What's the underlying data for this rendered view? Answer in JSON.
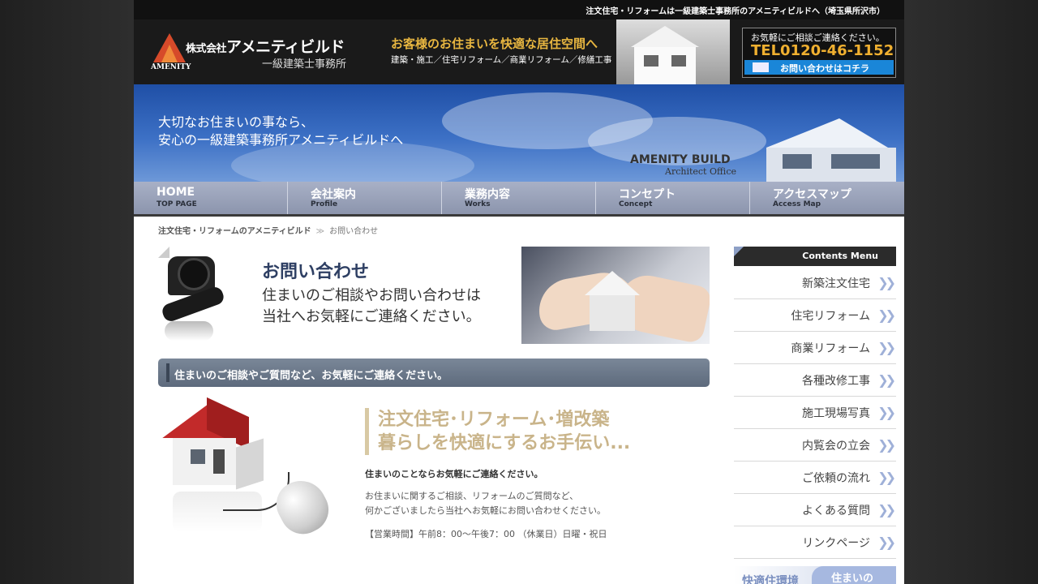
{
  "top_strip": {
    "text": "注文住宅・リフォームは一級建築士事務所のアメニティビルドへ（埼玉県所沢市）"
  },
  "header": {
    "logo_en": "AMENITY",
    "logo_jp_small": "株式会社",
    "logo_jp": "アメニティビルド",
    "logo_sub": "一級建築士事務所",
    "catch": "お客様のお住まいを快適な居住空間へ",
    "catch_sub": "建築・施工／住宅リフォーム／商業リフォーム／修繕工事",
    "contact_text": "お気軽にご相談ご連絡ください。",
    "contact_tel": "TEL0120-46-1152",
    "contact_button": "お問い合わせはコチラ"
  },
  "hero": {
    "line1": "大切なお住まいの事なら、",
    "line2": "安心の一級建築事務所アメニティビルドへ",
    "brand": "AMENITY BUILD",
    "brand_sub": "Architect Office"
  },
  "nav": [
    {
      "jp": "HOME",
      "en": "TOP PAGE"
    },
    {
      "jp": "会社案内",
      "en": "Profile"
    },
    {
      "jp": "業務内容",
      "en": "Works"
    },
    {
      "jp": "コンセプト",
      "en": "Concept"
    },
    {
      "jp": "アクセスマップ",
      "en": "Access Map"
    }
  ],
  "breadcrumb": {
    "home": "注文住宅・リフォームのアメニティビルド",
    "sep": "≫",
    "current": "お問い合わせ"
  },
  "banner": {
    "title": "お問い合わせ",
    "sub1": "住まいのご相談やお問い合わせは",
    "sub2": "当社へお気軽にご連絡ください。"
  },
  "section": {
    "heading": "住まいのご相談やご質問など、お気軽にご連絡ください。"
  },
  "content": {
    "catch1": "注文住宅･リフォーム･増改築",
    "catch2": "暮らしを快適にするお手伝い...",
    "lead": "住まいのことならお気軽にご連絡ください。",
    "body1": "お住まいに関するご相談、リフォームのご質問など、",
    "body2": "何かございましたら当社へお気軽にお問い合わせください。",
    "hours": "【営業時間】午前8：00～午後7：00 （休業日）日曜・祝日"
  },
  "sidebar": {
    "head": "Contents Menu",
    "items": [
      {
        "label": "新築注文住宅"
      },
      {
        "label": "住宅リフォーム"
      },
      {
        "label": "商業リフォーム"
      },
      {
        "label": "各種改修工事"
      },
      {
        "label": "施工現場写真"
      },
      {
        "label": "内覧会の立会"
      },
      {
        "label": "ご依頼の流れ"
      },
      {
        "label": "よくある質問"
      },
      {
        "label": "リンクページ"
      }
    ],
    "banner_left": "快適住環境",
    "banner_right": "住まいの"
  }
}
